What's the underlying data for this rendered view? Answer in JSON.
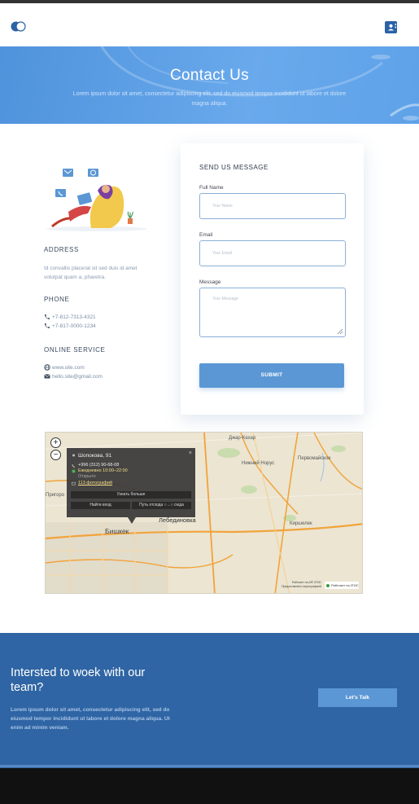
{
  "hero": {
    "title": "Contact Us",
    "subtitle": "Lorem ipsum dolor sit amet, consectetur adipiscing elit, sed do eiusmod tempor incididunt ut labore et dolore magna aliqua."
  },
  "info": {
    "address_heading": "ADDRESS",
    "address_text": "Id convallis placerat sit sed duis id amet volutpat quam a, pharetra.",
    "phone_heading": "PHONE",
    "phones": [
      "+7-812-7313-4321",
      "+7-817-0000-1234"
    ],
    "online_heading": "ONLINE SERVICE",
    "website": "www.site.com",
    "email": "hello.site@gmail.com"
  },
  "form": {
    "title": "SEND US MESSAGE",
    "full_name_label": "Full Name",
    "full_name_placeholder": "Your Name",
    "email_label": "Email",
    "email_placeholder": "Your Email",
    "message_label": "Message",
    "message_placeholder": "Your Message",
    "submit_label": "SUBMIT"
  },
  "map": {
    "zoom_in": "+",
    "zoom_out": "−",
    "places": {
      "dzhar_kachar": "Джар-Кахар",
      "nizhniy_norus": "Нижний Норус",
      "pervomayskoe": "Первомайское",
      "lebedinovka": "Лебединовка",
      "bishkek": "Бишкек",
      "kirshelek": "Киршелек",
      "prigorod": "Пригоро"
    },
    "popup": {
      "address": "Шопокова, 91",
      "phone": "+996 (312) 90-68-08",
      "hours": "Ежедневно 10:00–22:00",
      "status": "Открыто",
      "photos": "113 фотографий",
      "more": "Узнать больше",
      "entrance": "Найти вход",
      "route": "Путь отсюда",
      "route_to": "сюда",
      "close": "×"
    },
    "badge": "Работает на 2ГИС",
    "copyright": "Работает на API 2ГИС\nПредоставлено картографией"
  },
  "cta": {
    "title": "Intersted to woek with our team?",
    "text": "Lorem ipsum dolor sit amet, consectetur adipiscing elit, sed do eiusmod tempor incididunt ut labore et dolore magna aliqua. Ut enim ad minim veniam.",
    "button_label": "Let's Talk"
  },
  "colors": {
    "brand_blue": "#2f65a4",
    "accent_blue": "#5b97d4",
    "hero_blue": "#5fa2e8"
  },
  "icons": {
    "logo": "toggle-logo-icon",
    "contact": "contact-card-icon",
    "phone": "phone-icon",
    "globe": "globe-icon",
    "mail": "mail-icon"
  }
}
